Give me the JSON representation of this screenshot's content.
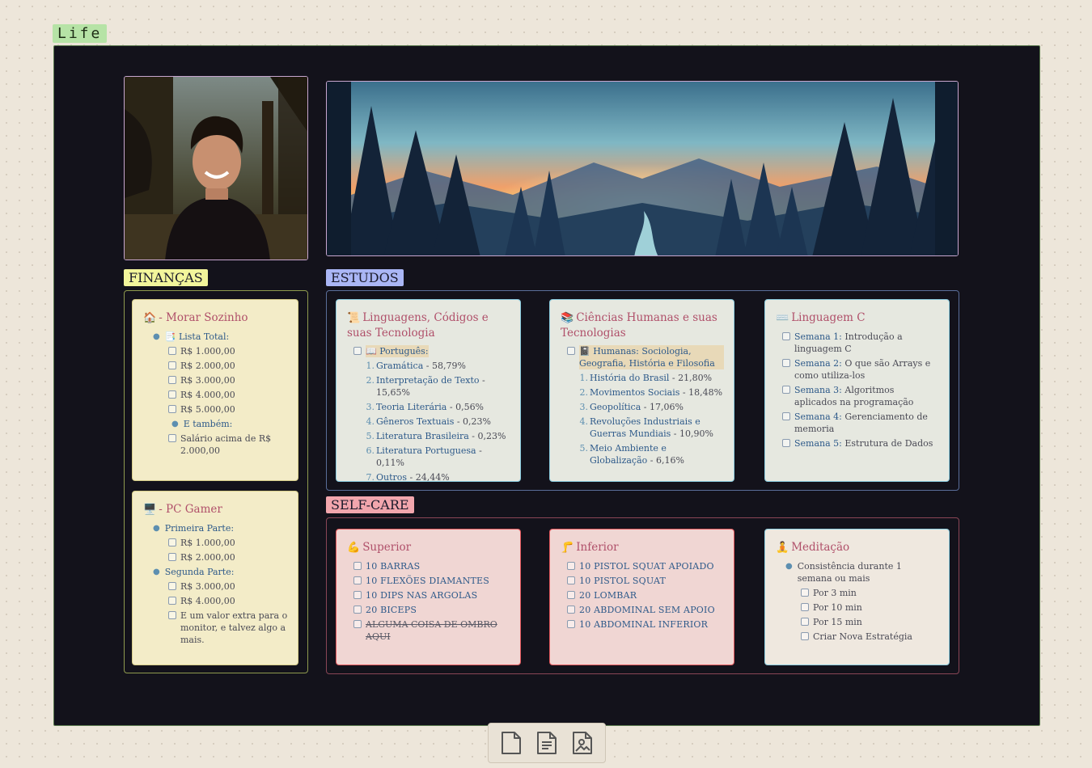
{
  "board": {
    "title": "Life"
  },
  "sections": {
    "financas": "FINANÇAS",
    "estudos": "ESTUDOS",
    "selfcare": "SELF-CARE"
  },
  "colors": {
    "board_bg": "#13121b",
    "financas_label": "#f2f59b",
    "estudos_label": "#aab6f5",
    "selfcare_label": "#f2a6ad",
    "card_heading": "#b0506a",
    "item_blue": "#2e5a8a"
  },
  "financas": {
    "morar": {
      "icon": "🏠",
      "title": "- Morar Sozinho",
      "list_icon": "📑",
      "list_label": "Lista Total:",
      "items": [
        "R$ 1.000,00",
        "R$ 2.000,00",
        "R$ 3.000,00",
        "R$ 4.000,00",
        "R$ 5.000,00"
      ],
      "also_label": "E também:",
      "also_item": "Salário acima de R$ 2.000,00"
    },
    "pc": {
      "icon": "🖥️",
      "title": "- PC Gamer",
      "part1": "Primeira Parte:",
      "part1_items": [
        "R$ 1.000,00",
        "R$ 2.000,00"
      ],
      "part2": "Segunda Parte:",
      "part2_items": [
        "R$ 3.000,00",
        "R$ 4.000,00",
        "E um valor extra para o monitor, e talvez algo a mais."
      ]
    }
  },
  "estudos": {
    "linguagens": {
      "icon": "📜",
      "title": "Linguagens, Códigos e suas Tecnologia",
      "sub_icon": "📖",
      "sub": "Português:",
      "items": [
        {
          "n": "1.",
          "name": "Gramática",
          "pct": " - 58,79%"
        },
        {
          "n": "2.",
          "name": "Interpretação de Texto",
          "pct": " - 15,65%"
        },
        {
          "n": "3.",
          "name": "Teoria Literária",
          "pct": " - 0,56%"
        },
        {
          "n": "4.",
          "name": "Gêneros Textuais",
          "pct": " - 0,23%"
        },
        {
          "n": "5.",
          "name": "Literatura Brasileira",
          "pct": " - 0,23%"
        },
        {
          "n": "6.",
          "name": "Literatura Portuguesa",
          "pct": " - 0,11%"
        },
        {
          "n": "7.",
          "name": "Outros",
          "pct": " - 24,44%"
        }
      ]
    },
    "humanas": {
      "icon": "📚",
      "title": "Ciências Humanas e suas Tecnologias",
      "sub_icon": "📓",
      "sub": "Humanas: Sociologia, Geografia, História e Filosofia",
      "items": [
        {
          "n": "1.",
          "name": "História do Brasil",
          "pct": " - 21,80%"
        },
        {
          "n": "2.",
          "name": "Movimentos Sociais",
          "pct": " - 18,48%"
        },
        {
          "n": "3.",
          "name": "Geopolítica",
          "pct": " - 17,06%"
        },
        {
          "n": "4.",
          "name": "Revoluções Industriais e Guerras Mundiais",
          "pct": " - 10,90%"
        },
        {
          "n": "5.",
          "name": "Meio Ambiente e Globalização",
          "pct": " - 6,16%"
        }
      ]
    },
    "linguagemc": {
      "icon": "⌨️",
      "title": "Linguagem C",
      "items": [
        {
          "week": "Semana 1:",
          "text": " Introdução a linguagem C"
        },
        {
          "week": "Semana 2:",
          "text": " O que são Arrays e como utiliza-los"
        },
        {
          "week": "Semana 3:",
          "text": " Algoritmos aplicados na programação"
        },
        {
          "week": "Semana 4:",
          "text": " Gerenciamento de memoria"
        },
        {
          "week": "Semana 5:",
          "text": " Estrutura de Dados"
        }
      ]
    }
  },
  "selfcare": {
    "superior": {
      "icon": "💪",
      "title": "Superior",
      "items": [
        "10 BARRAS",
        "10 FLEXÕES DIAMANTES",
        "10 DIPS NAS ARGOLAS",
        "20 BICEPS",
        "ALGUMA COISA DE OMBRO AQUI"
      ]
    },
    "inferior": {
      "icon": "🦵",
      "title": "Inferior",
      "items": [
        "10 PISTOL SQUAT APOIADO",
        "10 PISTOL SQUAT",
        "20 LOMBAR",
        "20 ABDOMINAL SEM APOIO",
        "10 ABDOMINAL INFERIOR"
      ]
    },
    "meditacao": {
      "icon": "🧘",
      "title": "Meditação",
      "bullet": "Consistência durante 1 semana ou mais",
      "items": [
        "Por 3 min",
        "Por 10 min",
        "Por 15 min",
        "Criar Nova Estratégia"
      ]
    }
  },
  "toolbar": {
    "icons": [
      "new-note-icon",
      "text-document-icon",
      "image-document-icon"
    ]
  }
}
